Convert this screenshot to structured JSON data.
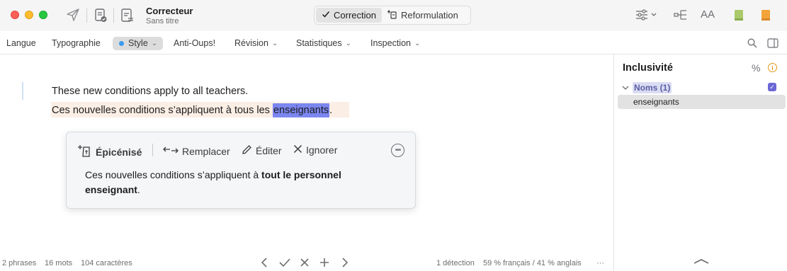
{
  "app": {
    "title": "Correcteur",
    "subtitle": "Sans titre"
  },
  "modes": [
    {
      "label": "Correction",
      "icon": "checkmark-icon",
      "active": true
    },
    {
      "label": "Reformulation",
      "icon": "reformulation-icon",
      "active": false
    }
  ],
  "toolbar_right": {
    "text_size_label": "AA"
  },
  "menu": [
    {
      "label": "Langue"
    },
    {
      "label": "Typographie"
    },
    {
      "label": "Style"
    },
    {
      "label": "Anti-Oups!"
    },
    {
      "label": "Révision"
    },
    {
      "label": "Statistiques"
    },
    {
      "label": "Inspection"
    }
  ],
  "editor": {
    "line1": "These new conditions apply to all teachers.",
    "line2_before": "Ces nouvelles conditions s’appliquent à tous les ",
    "line2_highlight": "enseignants",
    "line2_after": "."
  },
  "popover": {
    "category": "Épicénisé",
    "replace": "Remplacer",
    "edit": "Éditer",
    "ignore": "Ignorer",
    "suggestion_prefix": "Ces nouvelles conditions s’appliquent à ",
    "suggestion_bold": "tout le personnel enseignant",
    "suggestion_suffix": "."
  },
  "status": {
    "phrases": "2 phrases",
    "words": "16 mots",
    "chars": "104 caractères",
    "detections": "1 détection",
    "languages": "59 % français / 41 % anglais",
    "more": "···"
  },
  "side": {
    "title": "Inclusivité",
    "percent": "%",
    "info": "i",
    "group_label": "Noms (1)",
    "item": "enseignants"
  },
  "colors": {
    "highlight": "#7b86f0",
    "sentence_bg": "#fbeee4",
    "accent_purple": "#6a66d6",
    "style_dot": "#3b9cf0"
  }
}
